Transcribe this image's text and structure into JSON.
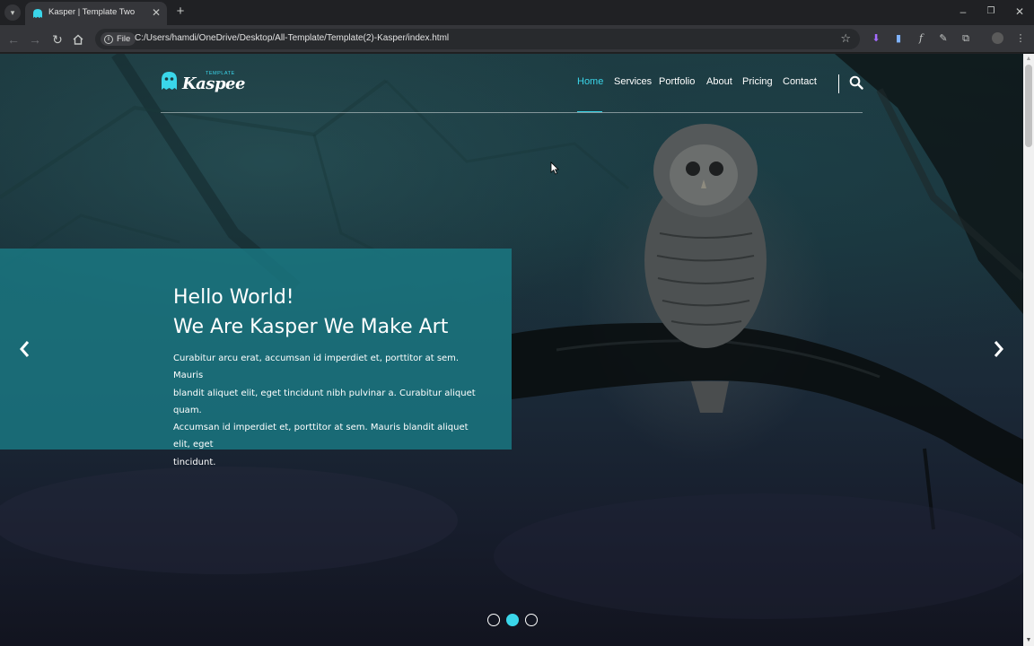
{
  "browser": {
    "tab_title": "Kasper | Template Two",
    "url_chip": "File",
    "url": "C:/Users/hamdi/OneDrive/Desktop/All-Template/Template(2)-Kasper/index.html"
  },
  "site": {
    "logo_text": "Kaspee",
    "logo_small_text": "TEMPLATE",
    "nav": [
      "Home",
      "Services",
      "Portfolio",
      "About",
      "Pricing",
      "Contact"
    ],
    "active_nav": "Home",
    "accent_color": "#3ad6ea",
    "box_color": "#197d88"
  },
  "hero": {
    "headline_line1": "Hello World!",
    "headline_line2": "We Are Kasper We Make Art",
    "desc_line1": "Curabitur arcu erat, accumsan id imperdiet et, porttitor at sem. Mauris",
    "desc_line2": "blandit aliquet elit, eget tincidunt nibh pulvinar a. Curabitur aliquet quam.",
    "desc_line3": "Accumsan id imperdiet et, porttitor at sem. Mauris blandit aliquet elit, eget",
    "desc_line4": "tincidunt.",
    "slide_count": 3,
    "active_slide": 2
  },
  "icons": {
    "tab_list": "chevron-down-icon",
    "back": "arrow-left-icon",
    "forward": "arrow-right-icon",
    "reload": "reload-icon",
    "home": "home-icon",
    "bookmark": "star-icon",
    "search": "search-icon",
    "prev": "chevron-left-icon",
    "next": "chevron-right-icon"
  }
}
